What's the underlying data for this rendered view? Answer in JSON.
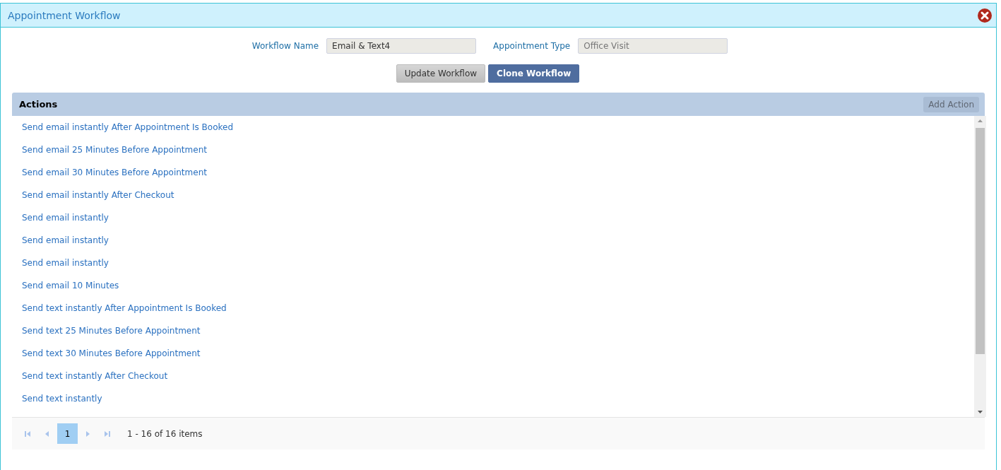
{
  "window": {
    "title": "Appointment Workflow"
  },
  "form": {
    "fields": [
      {
        "label": "Workflow Name",
        "value": "Email & Text4",
        "disabled": false
      },
      {
        "label": "Appointment Type",
        "value": "Office Visit",
        "disabled": true
      }
    ],
    "buttons": [
      {
        "label": "Update Workflow",
        "kind": "secondary"
      },
      {
        "label": "Clone Workflow",
        "kind": "primary"
      }
    ]
  },
  "actions": {
    "title": "Actions",
    "add_button": {
      "label": "Add Action",
      "disabled": true
    },
    "items": [
      "Send email instantly After Appointment Is Booked",
      "Send email 25 Minutes Before Appointment",
      "Send email 30 Minutes Before Appointment",
      "Send email instantly After Checkout",
      "Send email instantly",
      "Send email instantly",
      "Send email instantly",
      "Send email 10 Minutes",
      "Send text instantly After Appointment Is Booked",
      "Send text 25 Minutes Before Appointment",
      "Send text 30 Minutes Before Appointment",
      "Send text instantly After Checkout",
      "Send text instantly"
    ]
  },
  "pager": {
    "pages": [
      {
        "label": "1",
        "selected": true
      }
    ],
    "summary": "1 - 16 of 16 items"
  }
}
